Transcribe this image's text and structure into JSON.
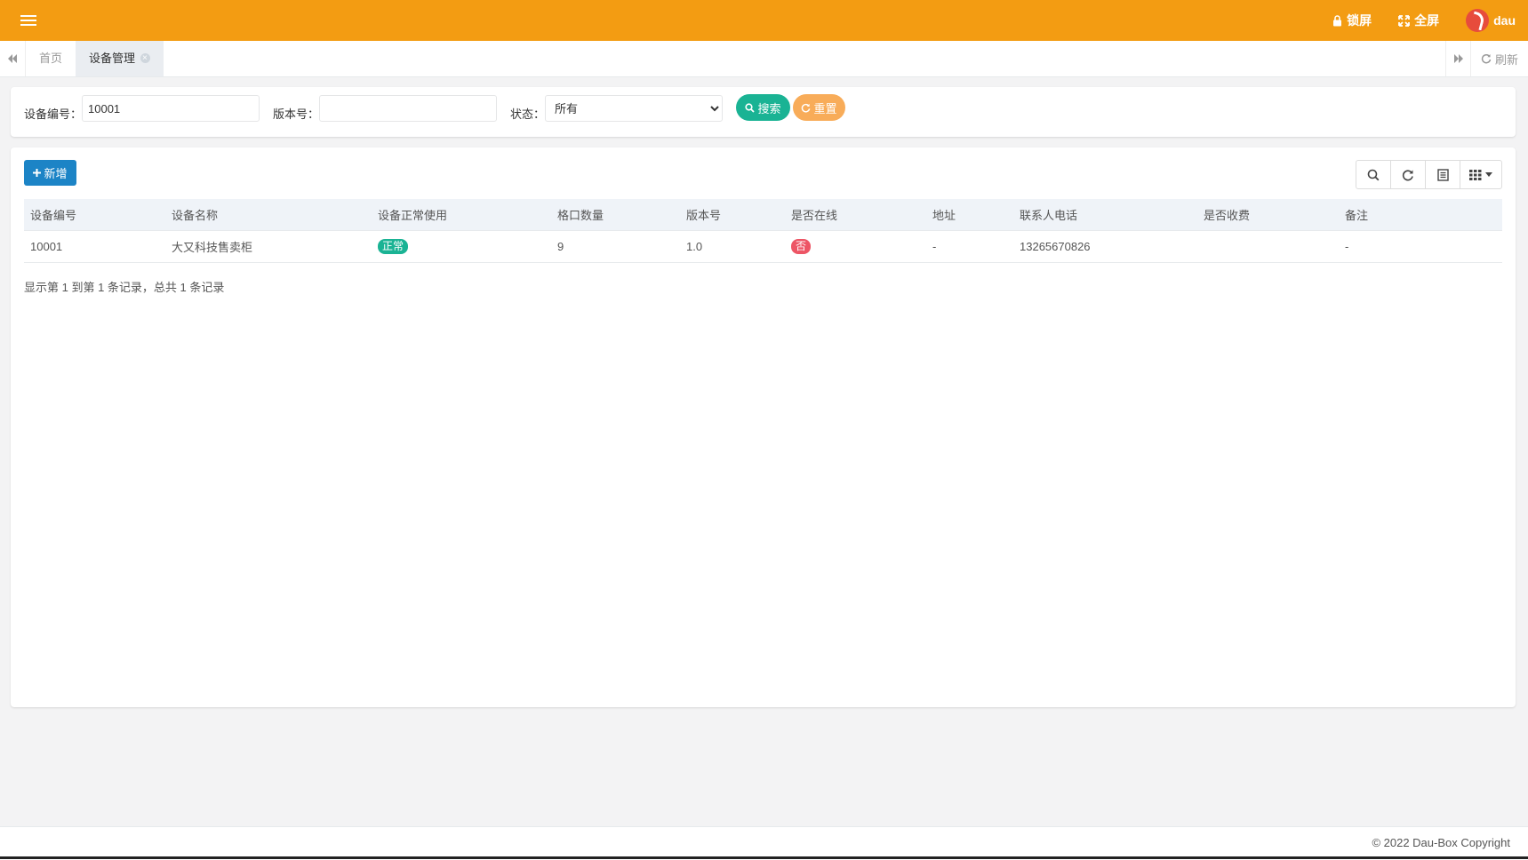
{
  "topbar": {
    "lock_label": "锁屏",
    "fullscreen_label": "全屏",
    "username": "dau",
    "bg_color": "#f39c12"
  },
  "tabs": {
    "items": [
      {
        "label": "首页"
      },
      {
        "label": "设备管理"
      }
    ],
    "refresh_label": "刷新"
  },
  "search": {
    "device_no_label": "设备编号：",
    "device_no_value": "10001",
    "version_label": "版本号：",
    "version_value": "",
    "status_label": "状态：",
    "status_selected": "所有",
    "search_button": "搜索",
    "reset_button": "重置"
  },
  "main": {
    "add_button": "新增",
    "toolbar_icons": [
      "search-icon",
      "refresh-icon",
      "list-icon",
      "columns-icon"
    ],
    "columns": [
      "设备编号",
      "设备名称",
      "设备正常使用",
      "格口数量",
      "版本号",
      "是否在线",
      "地址",
      "联系人电话",
      "是否收费",
      "备注"
    ],
    "rows": [
      {
        "device_no": "10001",
        "device_name": "大又科技售卖柜",
        "normal_use": "正常",
        "slot_count": "9",
        "version": "1.0",
        "online": "否",
        "address": "-",
        "phone": "13265670826",
        "charge": "",
        "remark": "-"
      }
    ],
    "pagination_info": "显示第 1 到第 1 条记录，总共 1 条记录"
  },
  "footer": {
    "copyright": "© 2022 Dau-Box Copyright"
  }
}
